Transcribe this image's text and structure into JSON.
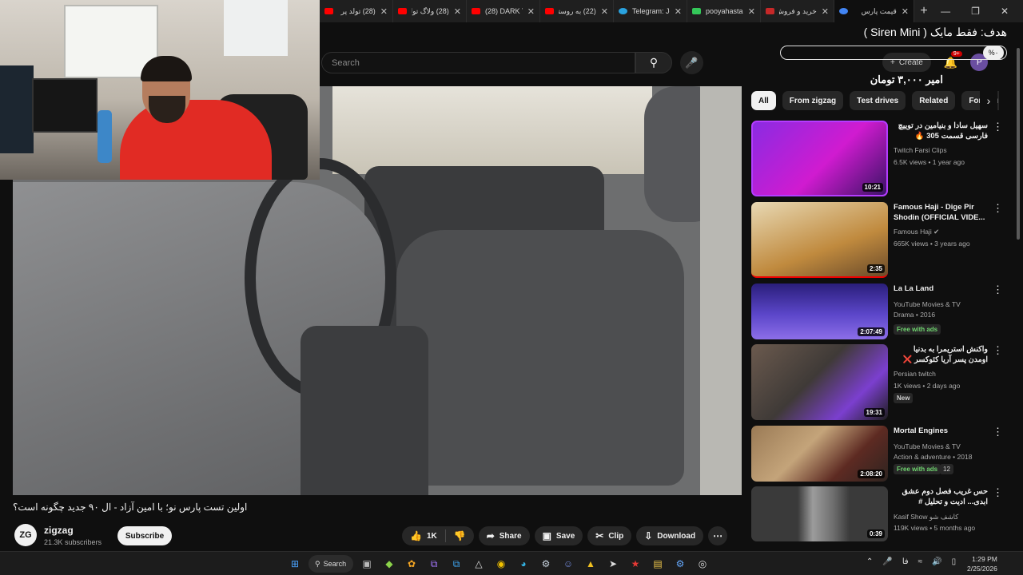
{
  "browser": {
    "tabs": [
      {
        "title": "(28) تولد پر",
        "color": "#ff0000"
      },
      {
        "title": "(28) ولاگ تولد",
        "color": "#ff0000"
      },
      {
        "title": "(28) DARK TI",
        "color": "#ff0000"
      },
      {
        "title": "(22) به روستا",
        "color": "#ff0000"
      },
      {
        "title": "Telegram: Jo",
        "color": "#2aa3e0"
      },
      {
        "title": "pooyahastan",
        "color": "#34c759"
      },
      {
        "title": "خرید و فروش",
        "color": "#c62828"
      },
      {
        "title": "قیمت پارس",
        "color": "#4285f4"
      }
    ],
    "new_tab": "+",
    "window_controls": [
      "—",
      "❐",
      "✕"
    ]
  },
  "header": {
    "search_placeholder": "Search",
    "create_label": "Create",
    "notif_badge": "9+",
    "avatar_letter": "P"
  },
  "overlay": {
    "goal_title": "هدف: فقط مایک ( Siren Mini )",
    "goal_percent": "%۰",
    "goal_amount": "امیر ۳,۰۰۰ تومان"
  },
  "video": {
    "title": "اولین تست پارس نو؛ با امین آزاد - ال ۹۰ جدید چگونه است؟",
    "channel": "zigzag",
    "channel_initials": "ZG",
    "subscribers": "21.3K subscribers",
    "subscribe_label": "Subscribe",
    "like_count": "1K",
    "share_label": "Share",
    "save_label": "Save",
    "clip_label": "Clip",
    "download_label": "Download"
  },
  "chips": [
    "All",
    "From zigzag",
    "Test drives",
    "Related",
    "For you"
  ],
  "recommendations": [
    {
      "title": "سهیل سادا و بنیامین در توییچ فارسی قسمت 305 🔥",
      "rtl": true,
      "channel": "Twitch Farsi Clips",
      "meta": "6.5K views • 1 year ago",
      "duration": "10:21",
      "tag": ""
    },
    {
      "title": "Famous Haji - Dige Pir Shodin (OFFICIAL VIDE...",
      "rtl": false,
      "channel": "Famous Haji ✔",
      "meta": "665K views • 3 years ago",
      "duration": "2:35",
      "tag": ""
    },
    {
      "title": "La La Land",
      "rtl": false,
      "channel": "YouTube Movies & TV",
      "meta": "Drama • 2016",
      "duration": "2:07:49",
      "tag": "Free with ads"
    },
    {
      "title": "واکنش استریمرا به بدنیا اومدن پسر آریا کئوکسر ❌ دعوای دعوسی ...",
      "rtl": true,
      "channel": "Persian twitch",
      "meta": "1K views • 2 days ago",
      "duration": "19:31",
      "tag": "New"
    },
    {
      "title": "Mortal Engines",
      "rtl": false,
      "channel": "YouTube Movies & TV",
      "meta": "Action & adventure • 2018",
      "duration": "2:08:20",
      "tag": "Free with ads",
      "count": "12"
    },
    {
      "title": "حس غریب فصل دوم عشق ابدی... ادیت و تحلیل # عشق_ابدی ...",
      "rtl": true,
      "channel": "Kasif Show کاشف شو",
      "meta": "119K views • 5 months ago",
      "duration": "0:39",
      "tag": ""
    }
  ],
  "taskbar": {
    "search_label": "Search",
    "time": "1:29 PM",
    "date": "2/25/2026"
  },
  "colors": {
    "accent_red": "#ff0000",
    "bg": "#0f0f0f",
    "chip_bg": "#272727"
  }
}
